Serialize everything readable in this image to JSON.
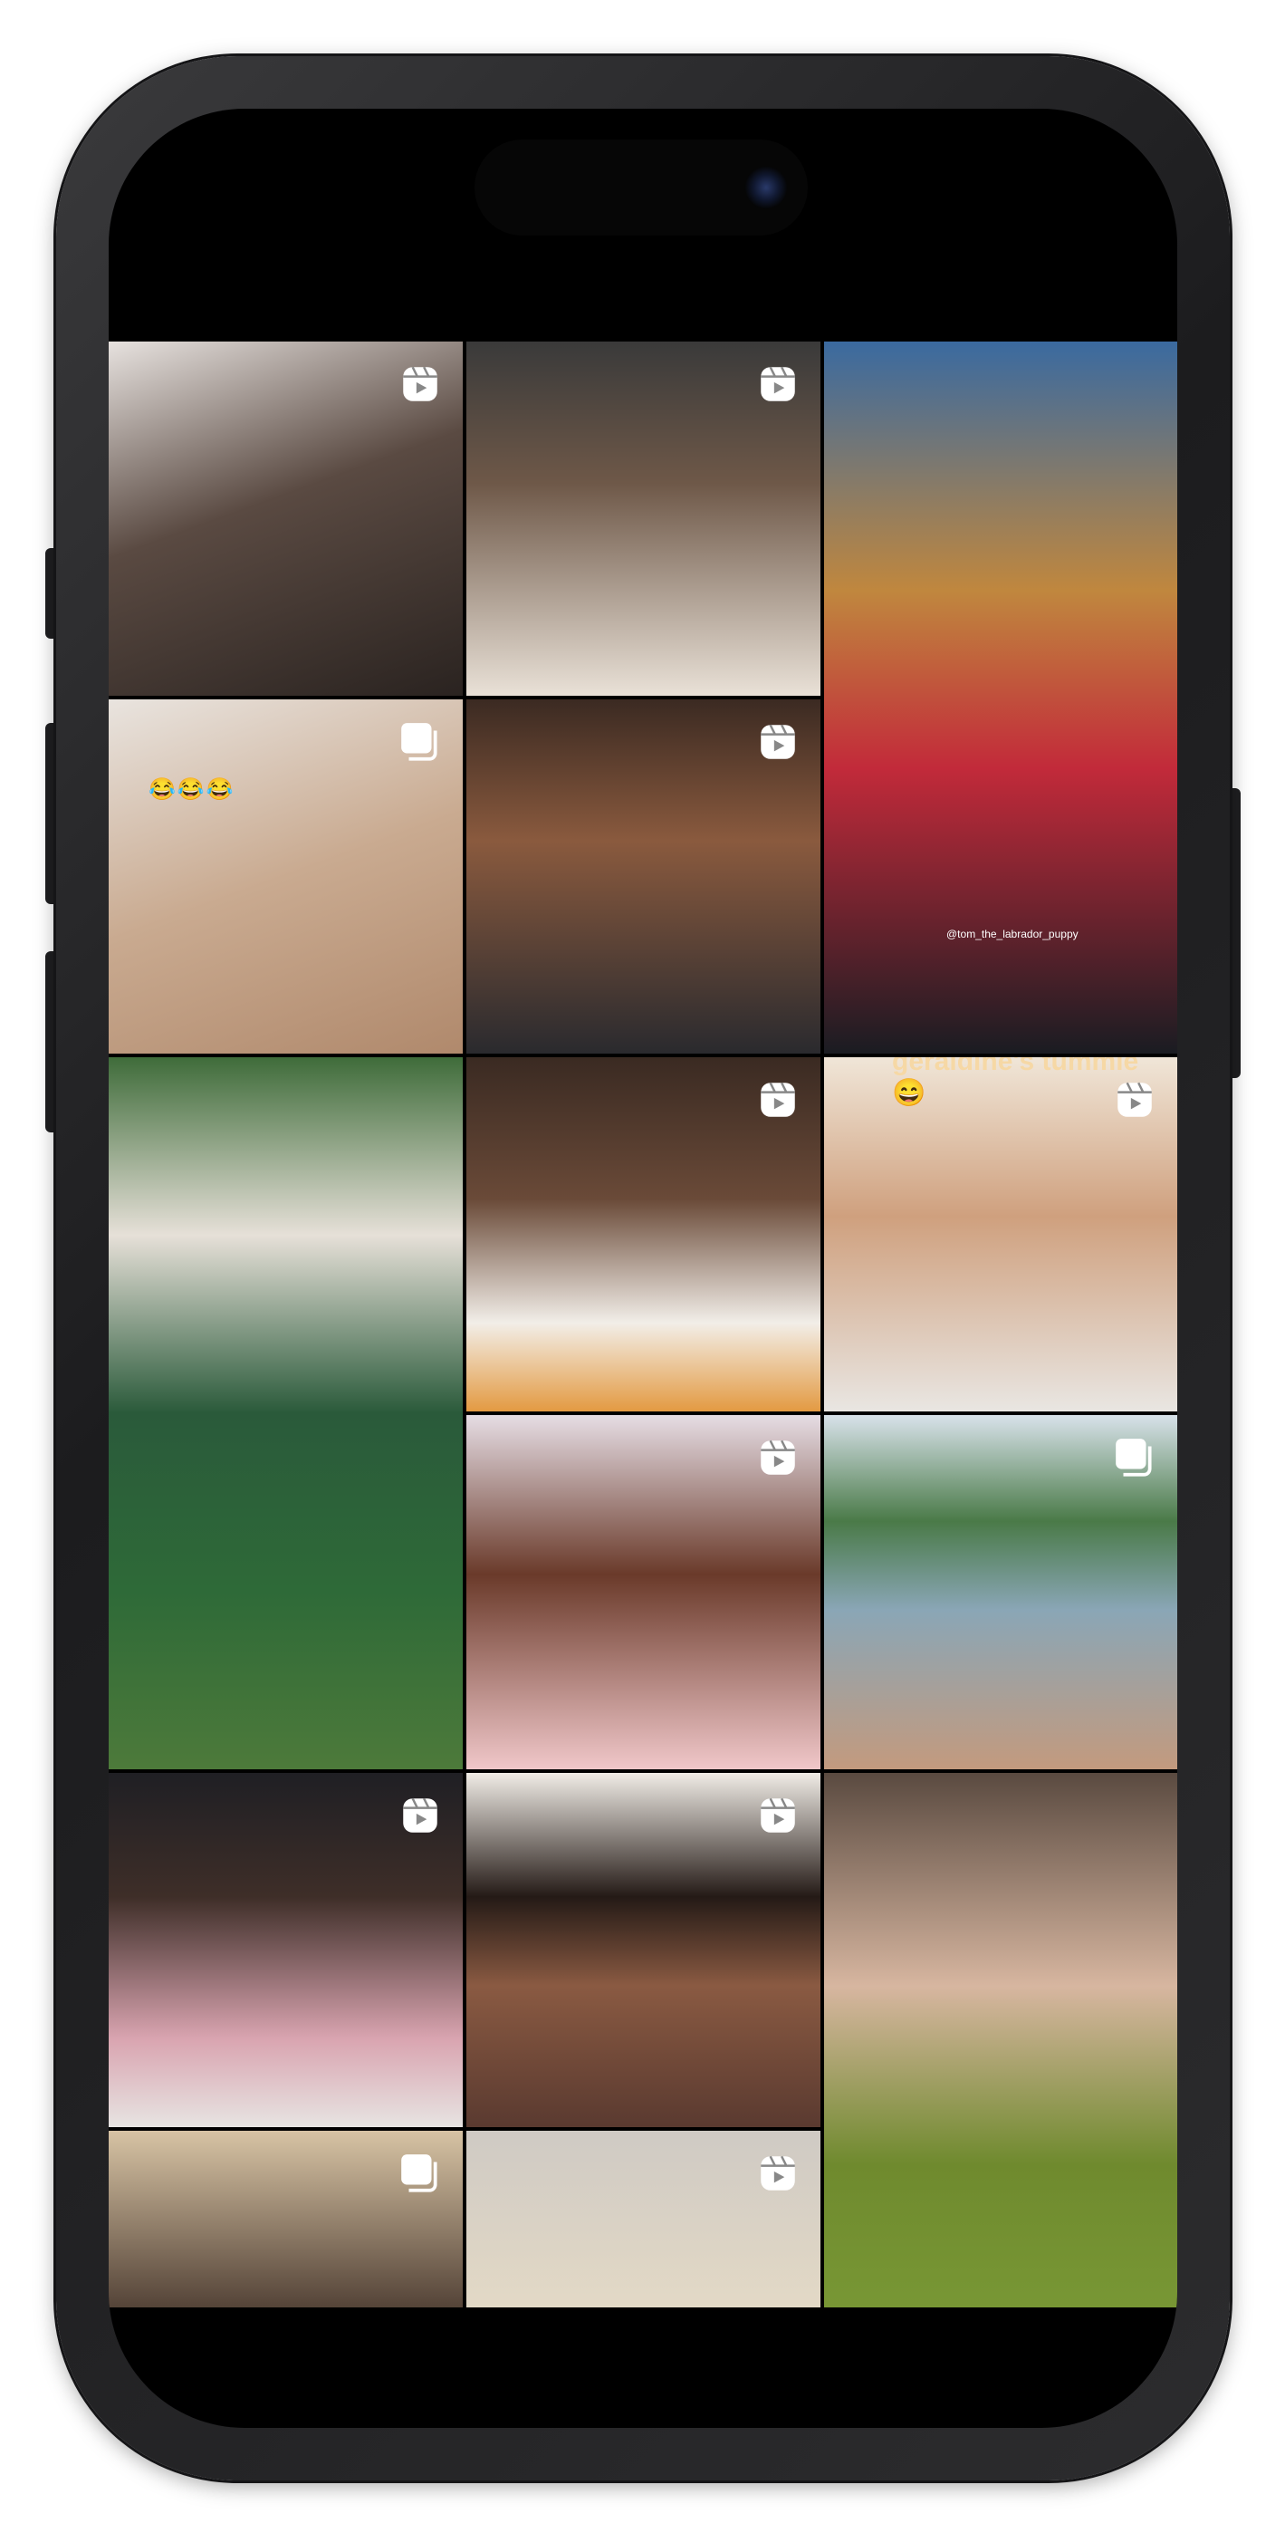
{
  "device": {
    "type": "phone",
    "frame_color": "#2c2c2e",
    "screen_color": "#000000"
  },
  "feed": {
    "tiles": [
      {
        "id": 1,
        "content": "baby sitting in car",
        "icon": "reels-icon"
      },
      {
        "id": 2,
        "content": "woman getting hair blow-dried",
        "icon": "reels-icon"
      },
      {
        "id": 3,
        "content": "golden retriever in red shirt",
        "icon": "none",
        "watermark": "@tom_the_labrador_puppy"
      },
      {
        "id": 4,
        "content": "toddler feet in sandals",
        "icon": "carousel-icon",
        "emoji": "😂😂😂"
      },
      {
        "id": 5,
        "content": "woman close-up portrait",
        "icon": "reels-icon"
      },
      {
        "id": 6,
        "content": "woman carrying rug over watermelons",
        "icon": "none"
      },
      {
        "id": 7,
        "content": "baby being fed",
        "icon": "reels-icon"
      },
      {
        "id": 8,
        "content": "woman holding baby",
        "icon": "reels-icon",
        "caption": "geraldine's tummie 😄"
      },
      {
        "id": 9,
        "content": "braiding a child's hair",
        "icon": "reels-icon"
      },
      {
        "id": 10,
        "content": "woman sitting by a lake",
        "icon": "carousel-icon"
      },
      {
        "id": 11,
        "content": "woman with braids smiling",
        "icon": "reels-icon"
      },
      {
        "id": 12,
        "content": "woman with bob haircut",
        "icon": "reels-icon"
      },
      {
        "id": 13,
        "content": "green matcha dessert balls",
        "icon": "none"
      },
      {
        "id": 14,
        "content": "portrait (partially visible)",
        "icon": "carousel-icon"
      },
      {
        "id": 15,
        "content": "portrait (partially visible)",
        "icon": "reels-icon"
      }
    ]
  }
}
